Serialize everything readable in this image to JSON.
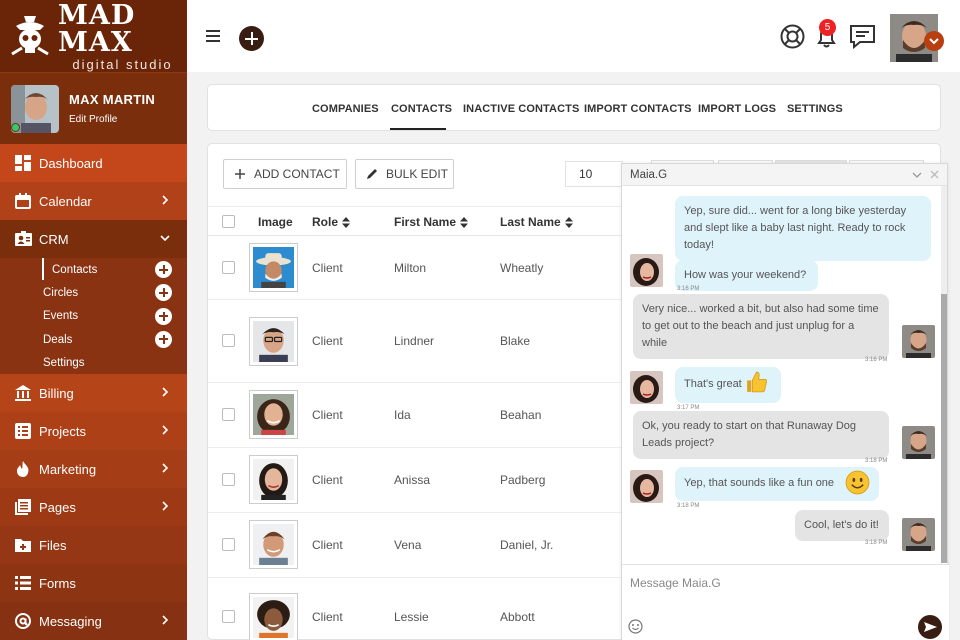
{
  "brand": {
    "title": "MAD MAX",
    "subtitle": "digital studio"
  },
  "profile": {
    "name": "MAX MARTIN",
    "edit": "Edit Profile"
  },
  "sidebar": {
    "items": [
      {
        "label": "Dashboard"
      },
      {
        "label": "Calendar"
      },
      {
        "label": "CRM"
      },
      {
        "label": "Billing"
      },
      {
        "label": "Projects"
      },
      {
        "label": "Marketing"
      },
      {
        "label": "Pages"
      },
      {
        "label": "Files"
      },
      {
        "label": "Forms"
      },
      {
        "label": "Messaging"
      }
    ],
    "crm_sub": [
      {
        "label": "Contacts"
      },
      {
        "label": "Circles"
      },
      {
        "label": "Events"
      },
      {
        "label": "Deals"
      },
      {
        "label": "Settings"
      }
    ]
  },
  "topbar": {
    "notifications": "5"
  },
  "tabs": [
    {
      "label": "COMPANIES"
    },
    {
      "label": "CONTACTS"
    },
    {
      "label": "INACTIVE CONTACTS"
    },
    {
      "label": "IMPORT CONTACTS"
    },
    {
      "label": "IMPORT LOGS"
    },
    {
      "label": "SETTINGS"
    }
  ],
  "toolbar": {
    "add_contact": "ADD CONTACT",
    "bulk_edit": "BULK EDIT",
    "page_size": "10"
  },
  "table": {
    "headers": {
      "image": "Image",
      "role": "Role",
      "first": "First Name",
      "last": "Last Name"
    },
    "rows": [
      {
        "role": "Client",
        "first": "Milton",
        "last": "Wheatly"
      },
      {
        "role": "Client",
        "first": "Lindner",
        "last": "Blake"
      },
      {
        "role": "Client",
        "first": "Ida",
        "last": "Beahan"
      },
      {
        "role": "Client",
        "first": "Anissa",
        "last": "Padberg"
      },
      {
        "role": "Client",
        "first": "Vena",
        "last": "Daniel, Jr."
      },
      {
        "role": "Client",
        "first": "Lessie",
        "last": "Abbott"
      }
    ]
  },
  "chat": {
    "contact": "Maia.G",
    "messages": [
      {
        "text": "Yep, sure did... went for a long bike yesterday and slept like a baby last night. Ready to rock today!",
        "time": ""
      },
      {
        "text": "How was your weekend?",
        "time": "3:16 PM"
      },
      {
        "text": "Very nice... worked a bit, but also had some time to get out to the beach and just unplug for a while",
        "time": "3:16 PM"
      },
      {
        "text": "That's great",
        "time": "3:17 PM"
      },
      {
        "text": "Ok, you ready to start on that Runaway Dog Leads project?",
        "time": "3:18 PM"
      },
      {
        "text": "Yep, that sounds like a fun one",
        "time": "3:18 PM"
      },
      {
        "text": "Cool, let's do it!",
        "time": "3:18 PM"
      }
    ],
    "placeholder": "Message Maia.G"
  }
}
